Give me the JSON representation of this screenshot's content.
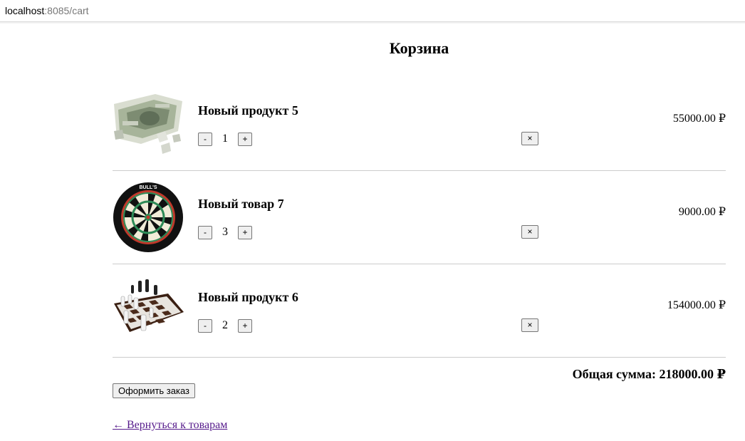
{
  "browser": {
    "url_host": "localhost",
    "url_rest": ":8085/cart"
  },
  "page": {
    "title": "Корзина"
  },
  "cart": {
    "items": [
      {
        "name": "Новый продукт 5",
        "quantity": "1",
        "price": "55000.00 ₽",
        "minus_label": "-",
        "plus_label": "+",
        "remove_label": "×",
        "image_icon": "money-puzzle-image"
      },
      {
        "name": "Новый товар 7",
        "quantity": "3",
        "price": "9000.00 ₽",
        "minus_label": "-",
        "plus_label": "+",
        "remove_label": "×",
        "image_icon": "dartboard-image"
      },
      {
        "name": "Новый продукт 6",
        "quantity": "2",
        "price": "154000.00 ₽",
        "minus_label": "-",
        "plus_label": "+",
        "remove_label": "×",
        "image_icon": "chess-board-image"
      }
    ],
    "total_label": "Общая сумма: 218000.00 ₽",
    "checkout_label": "Оформить заказ",
    "back_link_label": "← Вернуться к товарам"
  },
  "colors": {
    "link_visited": "#551a8b",
    "divider": "#cccccc",
    "button_bg": "#efefef",
    "button_border": "#767676"
  }
}
